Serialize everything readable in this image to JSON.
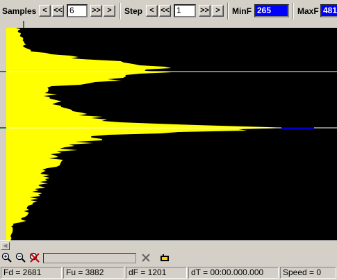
{
  "toolbar": {
    "samples_label": "Samples",
    "samples_value": "6",
    "step_label": "Step",
    "step_value": "1",
    "minf_label": "MinF",
    "minf_value": "265",
    "maxf_label": "MaxF",
    "maxf_value": "481",
    "btn_prev": "<",
    "btn_prev_fast": "<<",
    "btn_next_fast": ">>",
    "btn_next": ">"
  },
  "colors": {
    "spectrum": "#ffff00",
    "background": "#000000",
    "marker_line": "#ffffff",
    "peak_tail": "#0000cc",
    "edit_highlight": "#0000ff"
  },
  "icons": [
    "zoom-in-icon",
    "zoom-out-icon",
    "zoom-reset-icon",
    "clear-icon",
    "hand-icon"
  ],
  "status": {
    "fd": "Fd = 2681",
    "fu": "Fu = 3882",
    "df": "dF = 1201",
    "dt": "dT = 00:00.000.000",
    "speed": "Speed = 0"
  }
}
